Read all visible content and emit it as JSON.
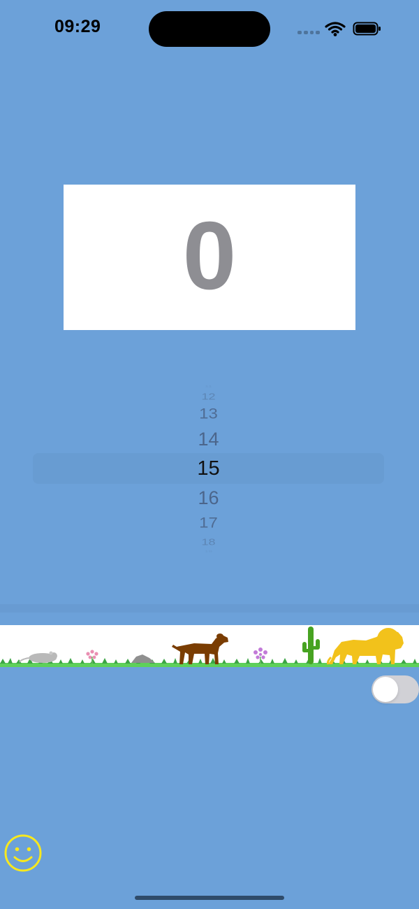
{
  "status_bar": {
    "time": "09:29",
    "icons": [
      "signal-dots-icon",
      "wifi-icon",
      "battery-icon"
    ]
  },
  "score": {
    "value": "0"
  },
  "picker": {
    "items": [
      "11",
      "12",
      "13",
      "14",
      "15",
      "16",
      "17",
      "18",
      "19"
    ],
    "selected": "15"
  },
  "scene": {
    "icons": [
      "mouse-icon",
      "pink-flower-icon",
      "rock-icon",
      "dog-icon",
      "purple-flower-icon",
      "cactus-icon",
      "lion-icon"
    ],
    "colors": {
      "grass": "#5ed05a",
      "dog": "#7a3d02",
      "lion": "#f2c21b",
      "cactus": "#47a321",
      "rock": "#8f8f8f",
      "mouse": "#b9b9b9",
      "pink_flower": "#ea8fb2",
      "purple_flower": "#c27ad8"
    }
  },
  "toggle": {
    "state": "off"
  },
  "bottom": {
    "icons": [
      "smiley-icon"
    ]
  },
  "theme": {
    "background": "#6ca1d9",
    "card": "#ffffff",
    "score_text": "#8e8e93"
  }
}
